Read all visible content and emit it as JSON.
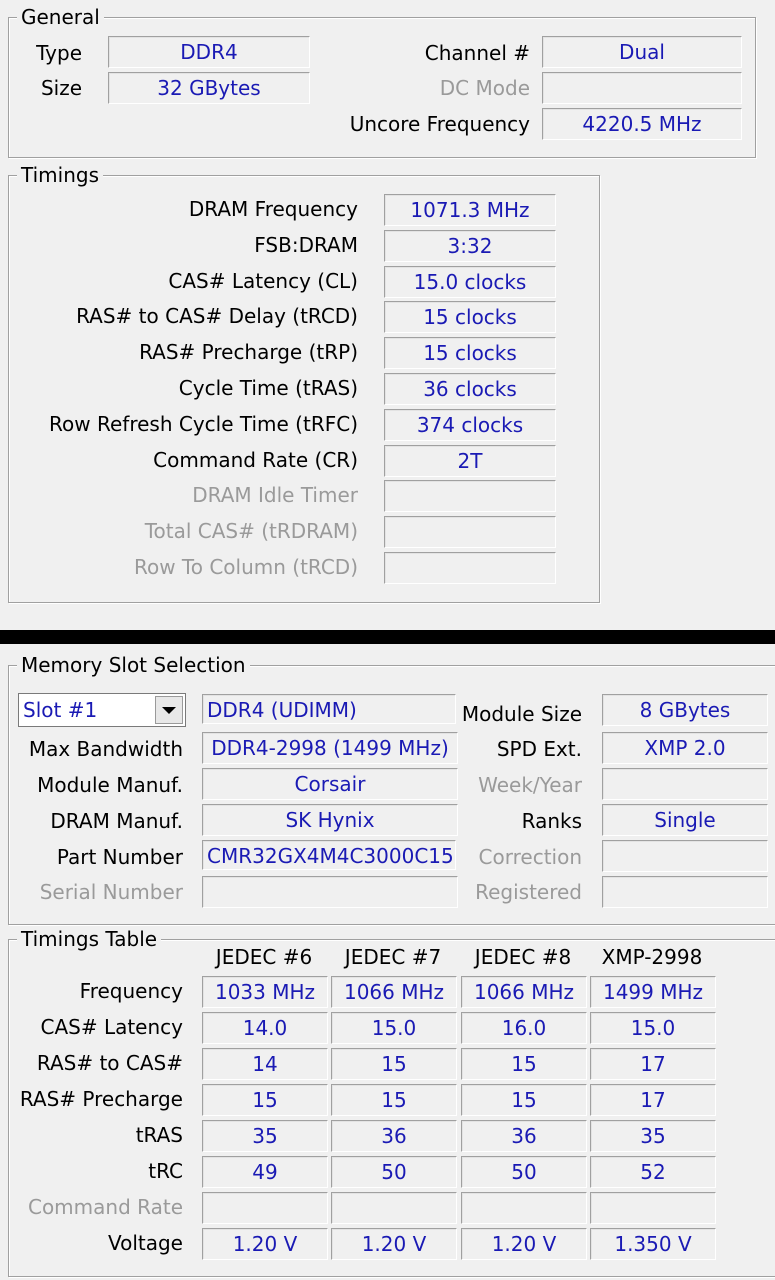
{
  "general": {
    "title": "General",
    "type_label": "Type",
    "type_value": "DDR4",
    "size_label": "Size",
    "size_value": "32 GBytes",
    "channel_label": "Channel #",
    "channel_value": "Dual",
    "dcmode_label": "DC Mode",
    "dcmode_value": "",
    "uncore_label": "Uncore Frequency",
    "uncore_value": "4220.5 MHz"
  },
  "timings": {
    "title": "Timings",
    "rows": [
      {
        "label": "DRAM Frequency",
        "value": "1071.3 MHz",
        "enabled": true
      },
      {
        "label": "FSB:DRAM",
        "value": "3:32",
        "enabled": true
      },
      {
        "label": "CAS# Latency (CL)",
        "value": "15.0 clocks",
        "enabled": true
      },
      {
        "label": "RAS# to CAS# Delay (tRCD)",
        "value": "15 clocks",
        "enabled": true
      },
      {
        "label": "RAS# Precharge (tRP)",
        "value": "15 clocks",
        "enabled": true
      },
      {
        "label": "Cycle Time (tRAS)",
        "value": "36 clocks",
        "enabled": true
      },
      {
        "label": "Row Refresh Cycle Time (tRFC)",
        "value": "374 clocks",
        "enabled": true
      },
      {
        "label": "Command Rate (CR)",
        "value": "2T",
        "enabled": true
      },
      {
        "label": "DRAM Idle Timer",
        "value": "",
        "enabled": false
      },
      {
        "label": "Total CAS# (tRDRAM)",
        "value": "",
        "enabled": false
      },
      {
        "label": "Row To Column (tRCD)",
        "value": "",
        "enabled": false
      }
    ]
  },
  "slot": {
    "title": "Memory Slot Selection",
    "selected": "Slot #1",
    "module_type": "DDR4 (UDIMM)",
    "max_bw_label": "Max Bandwidth",
    "max_bw_value": "DDR4-2998 (1499 MHz)",
    "manuf_label": "Module Manuf.",
    "manuf_value": "Corsair",
    "dram_manuf_label": "DRAM Manuf.",
    "dram_manuf_value": "SK Hynix",
    "part_label": "Part Number",
    "part_value": "CMR32GX4M4C3000C15",
    "serial_label": "Serial Number",
    "serial_value": "",
    "module_size_label": "Module Size",
    "module_size_value": "8 GBytes",
    "spd_label": "SPD Ext.",
    "spd_value": "XMP 2.0",
    "week_label": "Week/Year",
    "week_value": "",
    "ranks_label": "Ranks",
    "ranks_value": "Single",
    "correction_label": "Correction",
    "correction_value": "",
    "registered_label": "Registered",
    "registered_value": ""
  },
  "table": {
    "title": "Timings Table",
    "columns": [
      "JEDEC #6",
      "JEDEC #7",
      "JEDEC #8",
      "XMP-2998"
    ],
    "rows": [
      {
        "label": "Frequency",
        "enabled": true,
        "values": [
          "1033 MHz",
          "1066 MHz",
          "1066 MHz",
          "1499 MHz"
        ]
      },
      {
        "label": "CAS# Latency",
        "enabled": true,
        "values": [
          "14.0",
          "15.0",
          "16.0",
          "15.0"
        ]
      },
      {
        "label": "RAS# to CAS#",
        "enabled": true,
        "values": [
          "14",
          "15",
          "15",
          "17"
        ]
      },
      {
        "label": "RAS# Precharge",
        "enabled": true,
        "values": [
          "15",
          "15",
          "15",
          "17"
        ]
      },
      {
        "label": "tRAS",
        "enabled": true,
        "values": [
          "35",
          "36",
          "36",
          "35"
        ]
      },
      {
        "label": "tRC",
        "enabled": true,
        "values": [
          "49",
          "50",
          "50",
          "52"
        ]
      },
      {
        "label": "Command Rate",
        "enabled": false,
        "values": [
          "",
          "",
          "",
          ""
        ]
      },
      {
        "label": "Voltage",
        "enabled": true,
        "values": [
          "1.20 V",
          "1.20 V",
          "1.20 V",
          "1.350 V"
        ]
      }
    ]
  }
}
